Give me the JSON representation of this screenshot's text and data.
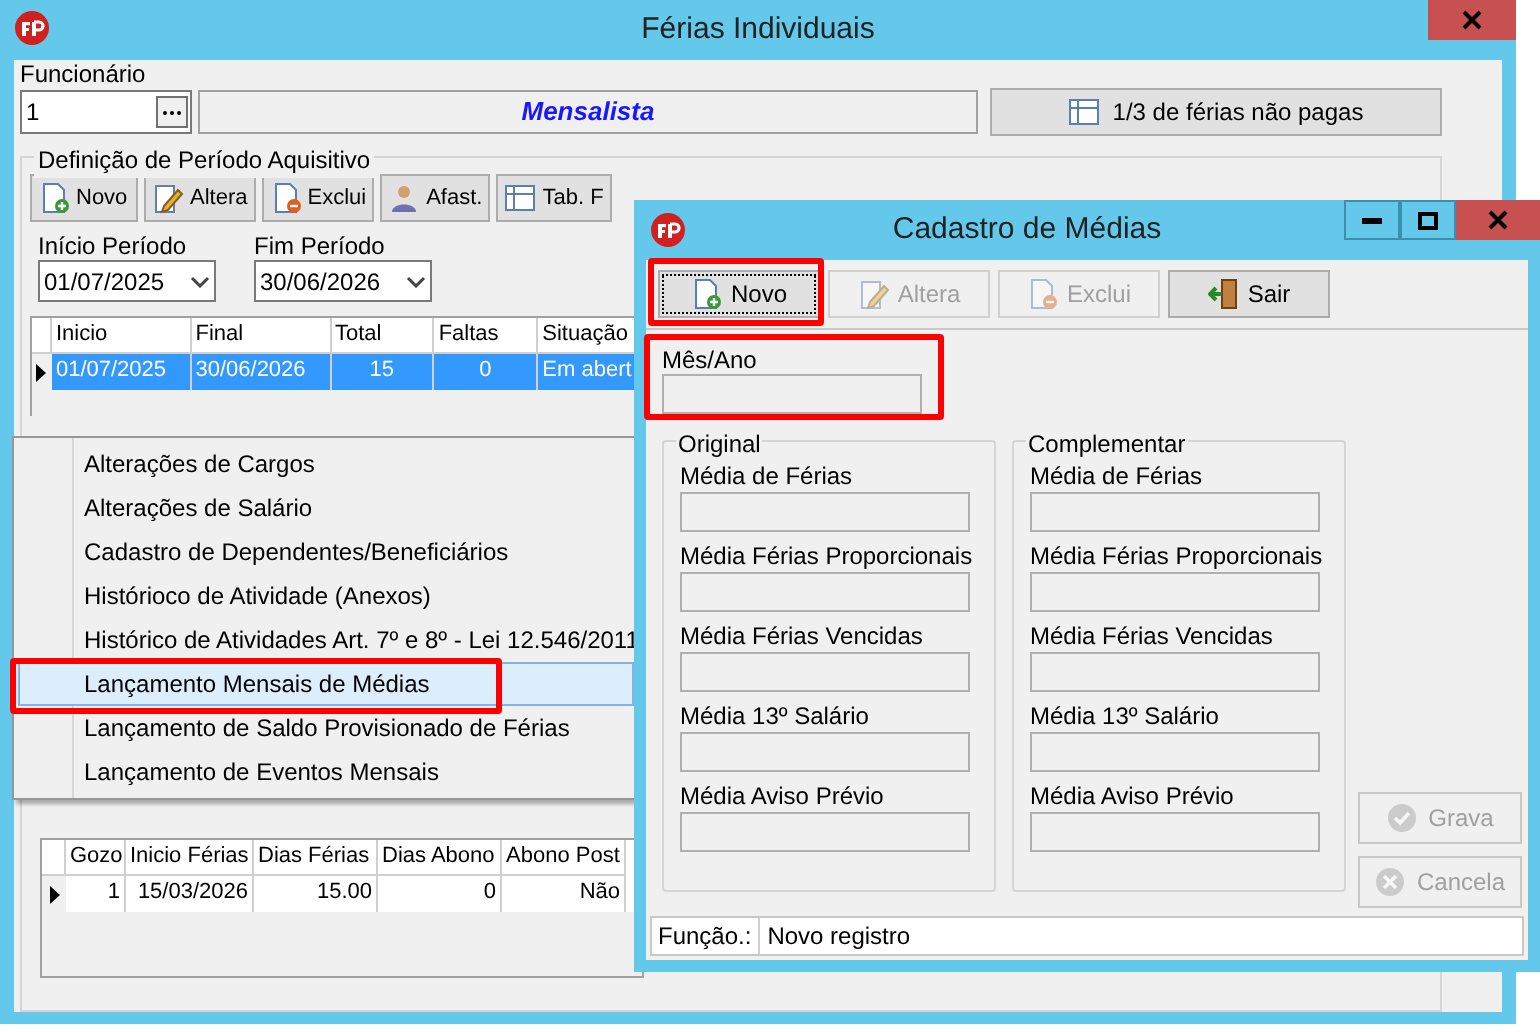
{
  "main_window": {
    "title": "Férias Individuais"
  },
  "employee": {
    "label": "Funcionário",
    "value": "1",
    "category": "Mensalista",
    "unpaid_button": "1/3 de férias não pagas"
  },
  "period_group": {
    "title": "Definição de Período Aquisitivo",
    "toolbar": [
      {
        "label": "Novo",
        "kind": "new"
      },
      {
        "label": "Altera",
        "kind": "edit"
      },
      {
        "label": "Exclui",
        "kind": "delete"
      },
      {
        "label": "Afast.",
        "kind": "leave"
      },
      {
        "label": "Tab. F",
        "kind": "table"
      }
    ],
    "start": {
      "label": "Início Período",
      "value": "01/07/2025"
    },
    "end": {
      "label": "Fim Período",
      "value": "30/06/2026"
    }
  },
  "periods_table": {
    "columns": [
      "Inicio",
      "Final",
      "Total",
      "Faltas",
      "Situação"
    ],
    "rows": [
      {
        "cells": [
          "01/07/2025",
          "30/06/2026",
          "15",
          "0",
          "Em abert"
        ],
        "selected": true
      }
    ]
  },
  "context_menu": {
    "items": [
      {
        "label": "Alterações de Cargos",
        "selected": false
      },
      {
        "label": "Alterações de Salário",
        "selected": false
      },
      {
        "label": "Cadastro de Dependentes/Beneficiários",
        "selected": false
      },
      {
        "label": "Histórioco de Atividade (Anexos)",
        "selected": false
      },
      {
        "label": "Histórico de Atividades Art. 7º e 8º - Lei 12.546/2011",
        "selected": false
      },
      {
        "label": "Lançamento Mensais de Médias",
        "selected": true
      },
      {
        "label": "Lançamento de Saldo Provisionado de Férias",
        "selected": false
      },
      {
        "label": "Lançamento de Eventos Mensais",
        "selected": false
      }
    ]
  },
  "vacations_table": {
    "columns": [
      "Gozo",
      "Inicio Férias",
      "Dias Férias",
      "Dias Abono",
      "Abono Post"
    ],
    "rows": [
      {
        "cells": [
          "1",
          "15/03/2026",
          "15.00",
          "0",
          "Não"
        ],
        "current": true
      }
    ]
  },
  "dialog": {
    "title": "Cadastro de Médias",
    "toolbar": [
      {
        "label": "Novo",
        "kind": "new",
        "disabled": false,
        "highlighted": true
      },
      {
        "label": "Altera",
        "kind": "edit",
        "disabled": true,
        "highlighted": false
      },
      {
        "label": "Exclui",
        "kind": "delete",
        "disabled": true,
        "highlighted": false
      },
      {
        "label": "Sair",
        "kind": "exit",
        "disabled": false,
        "highlighted": false
      }
    ],
    "month_field": {
      "label": "Mês/Ano",
      "highlighted": true
    },
    "groups": [
      {
        "title": "Original",
        "fields": [
          "Média de Férias",
          "Média Férias Proporcionais",
          "Média Férias Vencidas",
          "Média 13º Salário",
          "Média Aviso Prévio"
        ]
      },
      {
        "title": "Complementar",
        "fields": [
          "Média de Férias",
          "Média Férias Proporcionais",
          "Média Férias Vencidas",
          "Média 13º Salário",
          "Média Aviso Prévio"
        ]
      }
    ],
    "actions": [
      {
        "label": "Grava",
        "kind": "save",
        "disabled": true
      },
      {
        "label": "Cancela",
        "kind": "cancel",
        "disabled": true
      }
    ],
    "status": {
      "label": "Função.:",
      "value": "Novo registro"
    }
  }
}
